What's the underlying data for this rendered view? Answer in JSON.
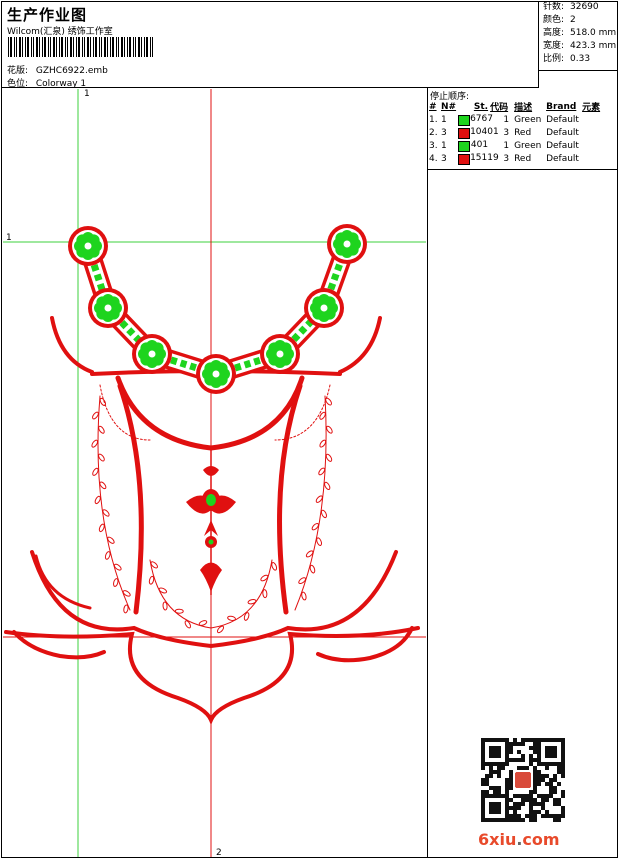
{
  "header": {
    "title": "生产作业图",
    "company": "Wilcom(汇泉) 绣饰工作室",
    "design_label": "花版:",
    "design_value": "GZHC6922.emb",
    "colorway_label": "色位:",
    "colorway_value": "Colorway 1"
  },
  "stats": [
    {
      "label": "针数:",
      "value": "32690"
    },
    {
      "label": "颜色:",
      "value": "2"
    },
    {
      "label": "高度:",
      "value": "518.0 mm"
    },
    {
      "label": "宽度:",
      "value": "423.3 mm"
    },
    {
      "label": "比例:",
      "value": "0.33"
    }
  ],
  "stop_sequence": {
    "title": "停止顺序:",
    "headers": [
      "#",
      "N#",
      "St.",
      "代码",
      "描述",
      "Brand",
      "元素"
    ],
    "rows": [
      {
        "idx": "1.",
        "n": "1",
        "color": "#1ed41e",
        "st": "6767",
        "code": "1",
        "desc": "Green",
        "brand": "Default"
      },
      {
        "idx": "2.",
        "n": "3",
        "color": "#e01010",
        "st": "10401",
        "code": "3",
        "desc": "Red",
        "brand": "Default"
      },
      {
        "idx": "3.",
        "n": "1",
        "color": "#1ed41e",
        "st": "401",
        "code": "1",
        "desc": "Green",
        "brand": "Default"
      },
      {
        "idx": "4.",
        "n": "3",
        "color": "#e01010",
        "st": "15119",
        "code": "3",
        "desc": "Red",
        "brand": "Default"
      }
    ]
  },
  "axis_labels": {
    "top": "1",
    "left": "1",
    "bottom": "2"
  },
  "watermark": {
    "main": "6xiu",
    "dot": ".",
    "tld": "com"
  },
  "colors": {
    "red": "#e01010",
    "green": "#1ed41e",
    "guide_green": "#3cd23c",
    "guide_red": "#e01010"
  }
}
